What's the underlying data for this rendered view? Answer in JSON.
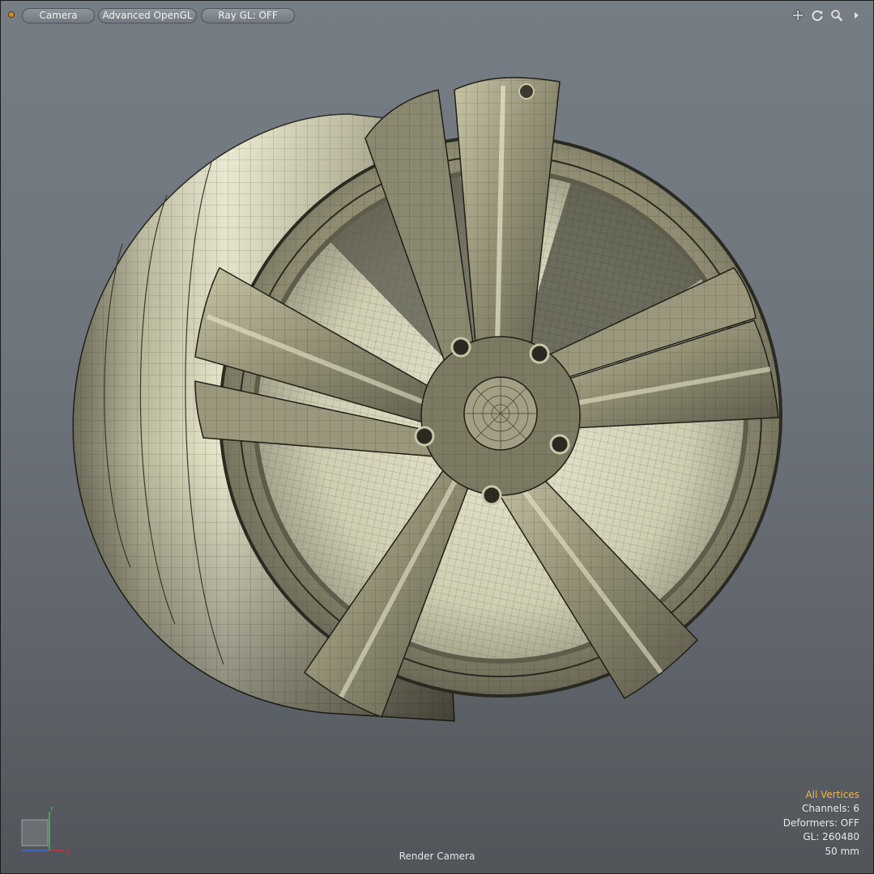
{
  "toolbar": {
    "camera_label": "Camera",
    "opengl_label": "Advanced OpenGL",
    "raygl_label": "Ray GL: OFF"
  },
  "nav_icons": [
    "move-icon",
    "rotate-icon",
    "zoom-icon",
    "expand-arrow-icon"
  ],
  "info": {
    "selection_mode": "All Vertices",
    "channels": "Channels: 6",
    "deformers": "Deformers: OFF",
    "gl": "GL: 260480",
    "focal_length": "50 mm"
  },
  "camera_name": "Render Camera",
  "axes": {
    "y_label": "Y",
    "x_label": "X"
  },
  "colors": {
    "selection_text": "#f4b42f",
    "axis_y": "#3fc43f",
    "axis_x": "#d03030",
    "axis_z": "#3a6ad8",
    "mesh_base": "#a9a58a",
    "mesh_highlight": "#e6e4c4"
  }
}
